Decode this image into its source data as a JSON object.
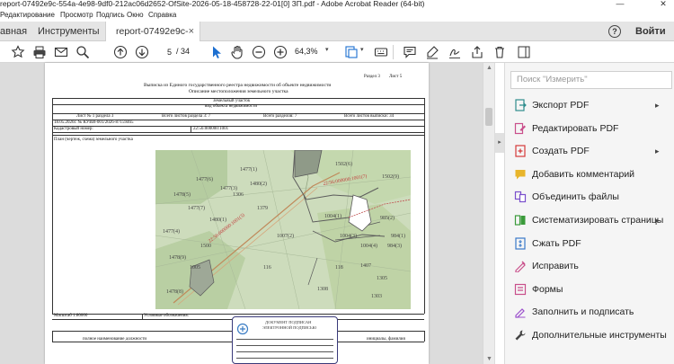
{
  "window": {
    "title": "report-07492e9c-554a-4e98-9df0-212ac06d2652-OfSite-2026-05-18-458728-22-01[0] ЗП.pdf - Adobe Acrobat Reader (64-bit)",
    "minimize": "—",
    "close": "✕"
  },
  "menu": {
    "items": [
      "Редактирование",
      "Просмотр",
      "Подпись",
      "Окно",
      "Справка"
    ]
  },
  "tabs": {
    "home": "авная",
    "tools": "Инструменты",
    "document": "report-07492e9c-5...",
    "close": "×",
    "help": "?",
    "signin": "Войти"
  },
  "toolbar": {
    "page_current": "5",
    "page_total": "/ 34",
    "zoom": "64,3%"
  },
  "document": {
    "section_header": "Раздел 3",
    "sheet_header": "Лист 5",
    "title1": "Выписка из Единого государственного реестра недвижимости об объекте недвижимости",
    "title2": "Описание местоположения земельного участка",
    "land_plot": "Земельный участок",
    "object_type": "вид объекта недвижимости",
    "sheet_no": "Лист № 1 раздела 3",
    "sheets_section": "Всего листов раздела 3: 7",
    "sections_total": "Всего разделов: 7",
    "sheets_total": "Всего листов выписки: 34",
    "date_no": "18.05.2026г. № КУВИ-001/2026-87159465",
    "cadastral_label": "Кадастровый номер:",
    "cadastral_value": "22:56:000000:1001",
    "plan_label": "План (чертеж, схема) земельного участка",
    "scale": "Масштаб 1:80000",
    "legend": "Условные обозначения:",
    "position_label": "полное наименование должности",
    "initials_label": "инициалы, фамилия",
    "stamp_line1": "ДОКУМЕНТ ПОДПИСАН",
    "stamp_line2": "ЭЛЕКТРОННОЙ ПОДПИСЬЮ",
    "map_labels": [
      "1477(1)",
      "1502(6)",
      "1477(6)",
      "1477(3)",
      "1480(2)",
      "1502(9)",
      "1478(5)",
      "1306",
      "1477(7)",
      "1379",
      "1480(1)",
      "1004(1)",
      "985(2)",
      "1007(2)",
      "1004(3)",
      "984(1)",
      "1004(4)",
      "984(3)",
      "1477(4)",
      "1500",
      "1478(9)",
      "1005",
      "116",
      "118",
      "1478(8)",
      "1407",
      "1305",
      "1308",
      "1303"
    ],
    "map_line_label": "22:56:000000:1001(3)",
    "map_line_label2": "22:56:000000:1001(7)"
  },
  "right_panel": {
    "search_placeholder": "Поиск \"Измерить\"",
    "items": [
      {
        "label": "Экспорт PDF",
        "chevron": true,
        "icon": "export-pdf-icon",
        "color": "#2f8d8d"
      },
      {
        "label": "Редактировать PDF",
        "chevron": false,
        "icon": "edit-pdf-icon",
        "color": "#c94f8b"
      },
      {
        "label": "Создать PDF",
        "chevron": true,
        "icon": "create-pdf-icon",
        "color": "#d43a3a"
      },
      {
        "label": "Добавить комментарий",
        "chevron": false,
        "icon": "comment-icon",
        "color": "#e8b52b"
      },
      {
        "label": "Объединить файлы",
        "chevron": false,
        "icon": "combine-files-icon",
        "color": "#7a4fcc"
      },
      {
        "label": "Систематизировать страницы",
        "chevron": true,
        "icon": "organize-pages-icon",
        "color": "#3b9b3b"
      },
      {
        "label": "Сжать PDF",
        "chevron": false,
        "icon": "compress-pdf-icon",
        "color": "#3a79c8"
      },
      {
        "label": "Исправить",
        "chevron": false,
        "icon": "fix-icon",
        "color": "#c94f8b"
      },
      {
        "label": "Формы",
        "chevron": false,
        "icon": "forms-icon",
        "color": "#c94f8b"
      },
      {
        "label": "Заполнить и подписать",
        "chevron": false,
        "icon": "fill-sign-icon",
        "color": "#9b4fcc"
      },
      {
        "label": "Дополнительные инструменты",
        "chevron": false,
        "icon": "more-tools-icon",
        "color": "#444444"
      }
    ],
    "chevron_glyph": "▸"
  }
}
